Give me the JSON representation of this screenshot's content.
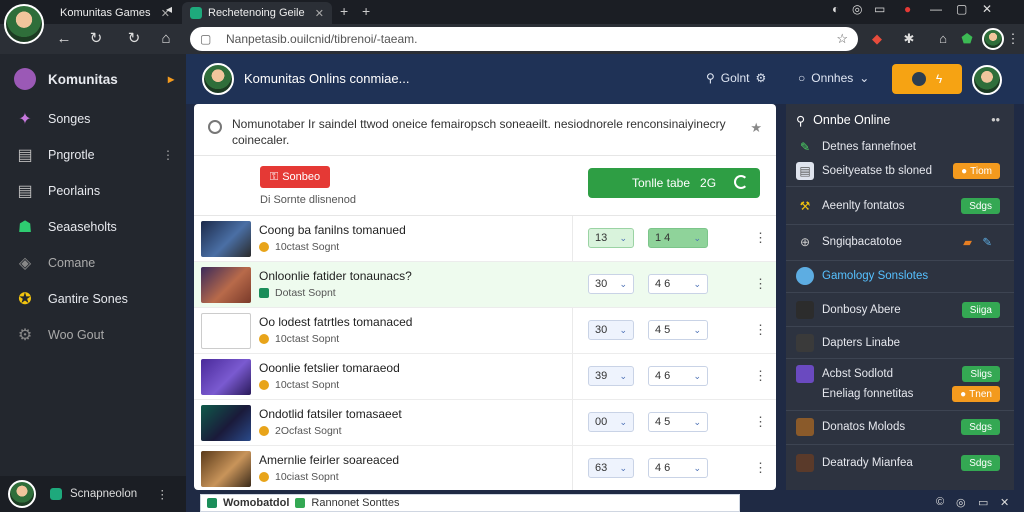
{
  "browser": {
    "tab1_title": "Komunitas Games",
    "tab2_title": "Rechetenoing Geile",
    "url": "Nanpetasib.ouilcnid/tibrenoi/-taeam."
  },
  "sidebar": {
    "header": "Komunitas",
    "items": [
      {
        "label": "Songes",
        "icon": "puzzle-icon"
      },
      {
        "label": "Pngrotle",
        "icon": "card-icon"
      },
      {
        "label": "Peorlains",
        "icon": "list-icon"
      },
      {
        "label": "Seaaseholts",
        "icon": "people-icon"
      },
      {
        "label": "Comane",
        "icon": "tag-icon"
      },
      {
        "label": "Gantire Sones",
        "icon": "trophy-icon"
      },
      {
        "label": "Woo Gout",
        "icon": "gear-icon"
      }
    ],
    "footer": "Scnapneolon"
  },
  "header": {
    "title": "Komunitas Onlins conmiae...",
    "search_label": "Golnt",
    "online_label": "Onnhes"
  },
  "panel": {
    "notice": "Nomunotaber Ir saindel ttwod oneice femairopsch soneaeilt. nesiodnorele renconsinaiyinecry coinecaler.",
    "red_button": "Sonbeo",
    "sub_text": "Di Sornte dlisnenod",
    "green_button_label": "Tonlle tabe",
    "green_button_count": "2G",
    "rows": [
      {
        "title": "Coong ba fanilns tomanued",
        "meta": "10ctast Sognt",
        "sel_a": "13",
        "sel_b": "1 4",
        "highlight": false
      },
      {
        "title": "Onloonlie fatider tonaunacs?",
        "meta": "Dotast Sopnt",
        "sel_a": "30",
        "sel_b": "4 6",
        "highlight": true
      },
      {
        "title": "Oo lodest fatrtles tomanaced",
        "meta": "10ctast Sopnt",
        "sel_a": "30",
        "sel_b": "4 5",
        "highlight": false
      },
      {
        "title": "Ooonlie fetslier tomaraeod",
        "meta": "10ctast Sopnt",
        "sel_a": "39",
        "sel_b": "4 6",
        "highlight": false
      },
      {
        "title": "Ondotlid fatsiler tomasaeet",
        "meta": "2Ocfast Sognt",
        "sel_a": "00",
        "sel_b": "4 5",
        "highlight": false
      },
      {
        "title": "Amernlie feirler soareaced",
        "meta": "10ciast Sopnt",
        "sel_a": "63",
        "sel_b": "4 6",
        "highlight": false
      }
    ]
  },
  "status": {
    "text1": "Womobatdol",
    "text2": "Rannonet Sonttes"
  },
  "right_panel": {
    "header": "Onnbe Online",
    "items": [
      {
        "label": "Detnes fannefnoet",
        "badge": "",
        "badge_color": ""
      },
      {
        "label": "Soeityeatse tb sloned",
        "badge": "Tiom",
        "badge_color": "orange"
      },
      {
        "label": "Aeenlty fontatos",
        "badge": "Sdgs",
        "badge_color": "green"
      },
      {
        "label": "Sngiqbacatotoe",
        "badge": "",
        "badge_color": ""
      },
      {
        "label": "Gamology Sonslotes",
        "badge": "",
        "badge_color": ""
      },
      {
        "label": "Donbosy Abere",
        "badge": "Siiga",
        "badge_color": "green"
      },
      {
        "label": "Dapters Linabe",
        "badge": "",
        "badge_color": ""
      },
      {
        "label": "Acbst Sodlotd",
        "badge": "Sligs",
        "badge_color": "green"
      },
      {
        "label": "Eneliag fonnetitas",
        "badge": "Tnen",
        "badge_color": "orange"
      },
      {
        "label": "Donatos Molods",
        "badge": "Sdgs",
        "badge_color": "green"
      },
      {
        "label": "Deatrady Mianfea",
        "badge": "Sdgs",
        "badge_color": "green"
      }
    ]
  },
  "colors": {
    "accent_green": "#2e9e44",
    "accent_orange": "#f6a313",
    "accent_red": "#e53935",
    "header_blue": "#1f3256"
  }
}
